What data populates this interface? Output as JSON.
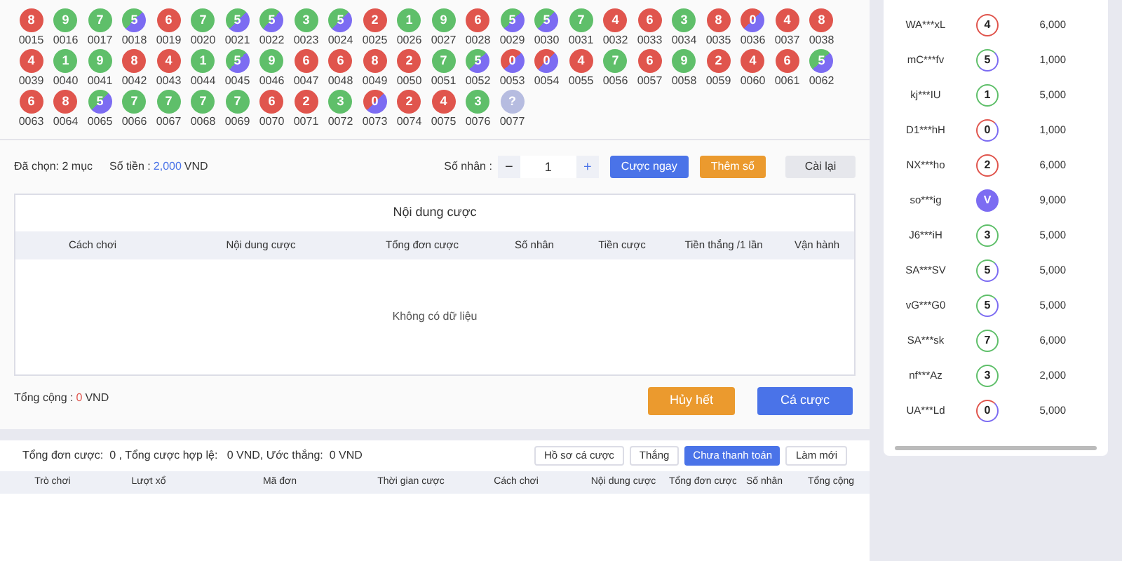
{
  "balls": [
    {
      "number": "8",
      "label": "0015",
      "kind": "red"
    },
    {
      "number": "9",
      "label": "0016",
      "kind": "green"
    },
    {
      "number": "7",
      "label": "0017",
      "kind": "green"
    },
    {
      "number": "5",
      "label": "0018",
      "kind": "greenviolet"
    },
    {
      "number": "6",
      "label": "0019",
      "kind": "red"
    },
    {
      "number": "7",
      "label": "0020",
      "kind": "green"
    },
    {
      "number": "5",
      "label": "0021",
      "kind": "greenviolet"
    },
    {
      "number": "5",
      "label": "0022",
      "kind": "greenviolet"
    },
    {
      "number": "3",
      "label": "0023",
      "kind": "green"
    },
    {
      "number": "5",
      "label": "0024",
      "kind": "greenviolet"
    },
    {
      "number": "2",
      "label": "0025",
      "kind": "red"
    },
    {
      "number": "1",
      "label": "0026",
      "kind": "green"
    },
    {
      "number": "9",
      "label": "0027",
      "kind": "green"
    },
    {
      "number": "6",
      "label": "0028",
      "kind": "red"
    },
    {
      "number": "5",
      "label": "0029",
      "kind": "greenviolet"
    },
    {
      "number": "5",
      "label": "0030",
      "kind": "greenviolet"
    },
    {
      "number": "7",
      "label": "0031",
      "kind": "green"
    },
    {
      "number": "4",
      "label": "0032",
      "kind": "red"
    },
    {
      "number": "6",
      "label": "0033",
      "kind": "red"
    },
    {
      "number": "3",
      "label": "0034",
      "kind": "green"
    },
    {
      "number": "8",
      "label": "0035",
      "kind": "red"
    },
    {
      "number": "0",
      "label": "0036",
      "kind": "redviolet"
    },
    {
      "number": "4",
      "label": "0037",
      "kind": "red"
    },
    {
      "number": "8",
      "label": "0038",
      "kind": "red"
    },
    {
      "number": "4",
      "label": "0039",
      "kind": "red"
    },
    {
      "number": "1",
      "label": "0040",
      "kind": "green"
    },
    {
      "number": "9",
      "label": "0041",
      "kind": "green"
    },
    {
      "number": "8",
      "label": "0042",
      "kind": "red"
    },
    {
      "number": "4",
      "label": "0043",
      "kind": "red"
    },
    {
      "number": "1",
      "label": "0044",
      "kind": "green"
    },
    {
      "number": "5",
      "label": "0045",
      "kind": "greenviolet"
    },
    {
      "number": "9",
      "label": "0046",
      "kind": "green"
    },
    {
      "number": "6",
      "label": "0047",
      "kind": "red"
    },
    {
      "number": "6",
      "label": "0048",
      "kind": "red"
    },
    {
      "number": "8",
      "label": "0049",
      "kind": "red"
    },
    {
      "number": "2",
      "label": "0050",
      "kind": "red"
    },
    {
      "number": "7",
      "label": "0051",
      "kind": "green"
    },
    {
      "number": "5",
      "label": "0052",
      "kind": "greenviolet"
    },
    {
      "number": "0",
      "label": "0053",
      "kind": "redviolet"
    },
    {
      "number": "0",
      "label": "0054",
      "kind": "redviolet"
    },
    {
      "number": "4",
      "label": "0055",
      "kind": "red"
    },
    {
      "number": "7",
      "label": "0056",
      "kind": "green"
    },
    {
      "number": "6",
      "label": "0057",
      "kind": "red"
    },
    {
      "number": "9",
      "label": "0058",
      "kind": "green"
    },
    {
      "number": "2",
      "label": "0059",
      "kind": "red"
    },
    {
      "number": "4",
      "label": "0060",
      "kind": "red"
    },
    {
      "number": "6",
      "label": "0061",
      "kind": "red"
    },
    {
      "number": "5",
      "label": "0062",
      "kind": "greenviolet"
    },
    {
      "number": "6",
      "label": "0063",
      "kind": "red"
    },
    {
      "number": "8",
      "label": "0064",
      "kind": "red"
    },
    {
      "number": "5",
      "label": "0065",
      "kind": "greenviolet"
    },
    {
      "number": "7",
      "label": "0066",
      "kind": "green"
    },
    {
      "number": "7",
      "label": "0067",
      "kind": "green"
    },
    {
      "number": "7",
      "label": "0068",
      "kind": "green"
    },
    {
      "number": "7",
      "label": "0069",
      "kind": "green"
    },
    {
      "number": "6",
      "label": "0070",
      "kind": "red"
    },
    {
      "number": "2",
      "label": "0071",
      "kind": "red"
    },
    {
      "number": "3",
      "label": "0072",
      "kind": "green"
    },
    {
      "number": "0",
      "label": "0073",
      "kind": "redviolet"
    },
    {
      "number": "2",
      "label": "0074",
      "kind": "red"
    },
    {
      "number": "4",
      "label": "0075",
      "kind": "red"
    },
    {
      "number": "3",
      "label": "0076",
      "kind": "green"
    },
    {
      "number": "?",
      "label": "0077",
      "kind": "pending"
    }
  ],
  "selection": {
    "chosen": "Đã chọn: 2 mục",
    "amount_label": "Số tiền :",
    "amount": "2,000",
    "currency": "VND",
    "multiplier_label": "Số nhân :",
    "minus": "−",
    "multiplier": "1",
    "plus": "+"
  },
  "actions": [
    "Cược ngay",
    "Thêm số",
    "Cài lại"
  ],
  "bet_table": {
    "title": "Nội dung cược",
    "columns": [
      "Cách chơi",
      "Nội dung cược",
      "Tổng đơn cược",
      "Số nhân",
      "Tiền cược",
      "Tiền thắng /1 lần",
      "Vận hành"
    ],
    "empty": "Không có dữ liệu"
  },
  "total": {
    "label": "Tổng cộng :",
    "value": "0",
    "currency": "VND"
  },
  "submit": [
    "Hủy hết",
    "Cá cược"
  ],
  "history": {
    "summary": "Tổng đơn cược:  0 , Tổng cược hợp lệ:   0 VND, Ước thắng:  0 VND",
    "tabs": [
      {
        "label": "Hồ sơ cá cược",
        "selected": false
      },
      {
        "label": "Thắng",
        "selected": false
      },
      {
        "label": "Chưa thanh toán",
        "selected": true
      },
      {
        "label": "Làm mới",
        "selected": false
      }
    ],
    "columns": [
      "Trò chơi",
      "Lượt xổ",
      "Mã đơn",
      "Thời gian cược",
      "Cách chơi",
      "Nội dung cược",
      "Tổng đơn cược",
      "Số nhân",
      "Tổng cộng"
    ]
  },
  "winners": [
    {
      "name": "WA***xL",
      "result": "4",
      "kind": "red",
      "amount": "6,000"
    },
    {
      "name": "mC***fv",
      "result": "5",
      "kind": "greenviolet",
      "amount": "1,000"
    },
    {
      "name": "kj***IU",
      "result": "1",
      "kind": "green",
      "amount": "5,000"
    },
    {
      "name": "D1***hH",
      "result": "0",
      "kind": "redviolet",
      "amount": "1,000"
    },
    {
      "name": "NX***ho",
      "result": "2",
      "kind": "red",
      "amount": "6,000"
    },
    {
      "name": "so***ig",
      "result": "V",
      "kind": "violet",
      "amount": "9,000"
    },
    {
      "name": "J6***iH",
      "result": "3",
      "kind": "green",
      "amount": "5,000"
    },
    {
      "name": "SA***SV",
      "result": "5",
      "kind": "greenviolet",
      "amount": "5,000"
    },
    {
      "name": "vG***G0",
      "result": "5",
      "kind": "greenviolet",
      "amount": "5,000"
    },
    {
      "name": "SA***sk",
      "result": "7",
      "kind": "green",
      "amount": "6,000"
    },
    {
      "name": "nf***Az",
      "result": "3",
      "kind": "green",
      "amount": "2,000"
    },
    {
      "name": "UA***Ld",
      "result": "0",
      "kind": "redviolet",
      "amount": "5,000"
    }
  ]
}
